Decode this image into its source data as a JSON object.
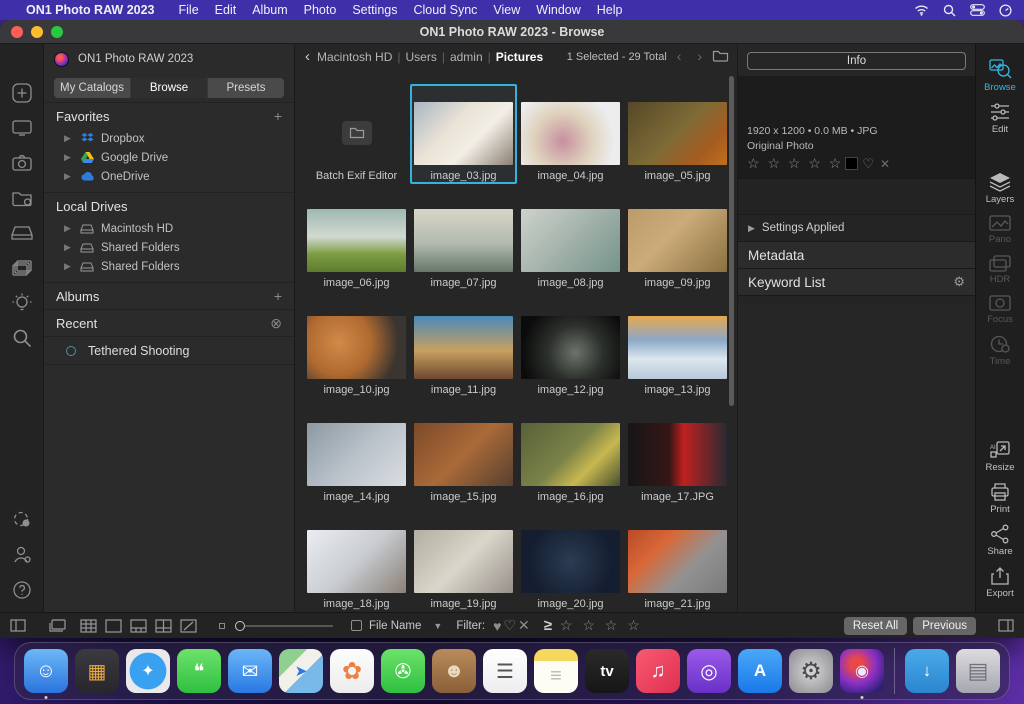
{
  "menu_bar": {
    "apple": "",
    "app_name": "ON1 Photo RAW 2023",
    "items": [
      "File",
      "Edit",
      "Album",
      "Photo",
      "Settings",
      "Cloud Sync",
      "View",
      "Window",
      "Help"
    ]
  },
  "window": {
    "title": "ON1 Photo RAW 2023 - Browse"
  },
  "sidebar": {
    "app_label": "ON1 Photo RAW 2023",
    "tabs": [
      {
        "label": "My Catalogs"
      },
      {
        "label": "Browse"
      },
      {
        "label": "Presets"
      }
    ],
    "favorites": {
      "title": "Favorites",
      "add": "+",
      "items": [
        {
          "label": "Dropbox"
        },
        {
          "label": "Google Drive"
        },
        {
          "label": "OneDrive"
        }
      ]
    },
    "local_drives": {
      "title": "Local Drives",
      "items": [
        {
          "label": "Macintosh HD"
        },
        {
          "label": "Shared Folders"
        },
        {
          "label": "Shared Folders"
        }
      ]
    },
    "albums": {
      "title": "Albums",
      "add": "+"
    },
    "recent": {
      "title": "Recent",
      "clear": "⊗"
    },
    "tethered": {
      "label": "Tethered Shooting"
    }
  },
  "main": {
    "breadcrumb": {
      "back": "‹",
      "parts": [
        "Macintosh HD",
        "Users",
        "admin"
      ],
      "current": "Pictures"
    },
    "selection": "1 Selected - 29 Total",
    "nav_arrows": "‹ ›",
    "grid": {
      "items": [
        {
          "type": "folder",
          "label": "Batch Exif Editor"
        },
        {
          "type": "image",
          "label": "image_03.jpg",
          "selected": true,
          "bg": "linear-gradient(135deg,#a8b6c2 0%,#e9e2d6 38%,#f3efe6 62%,#8a7f72 100%)"
        },
        {
          "type": "image",
          "label": "image_04.jpg",
          "bg": "radial-gradient(circle at 42% 62%,#c78fa0 0%,#dfd3bd 42%,#ededef 75%)"
        },
        {
          "type": "image",
          "label": "image_05.jpg",
          "bg": "linear-gradient(135deg,#564728 0%,#7c6b36 48%,#a65c20 78%,#c2701e 100%)"
        },
        {
          "type": "image",
          "label": "image_06.jpg",
          "bg": "linear-gradient(180deg,#9db9b1 0%,#d2d9d0 44%,#7d9c42 72%,#5d7c30 100%)"
        },
        {
          "type": "image",
          "label": "image_07.jpg",
          "bg": "linear-gradient(180deg,#d9d5c8 0%,#b2bab0 55%,#66766a 100%)"
        },
        {
          "type": "image",
          "label": "image_08.jpg",
          "bg": "linear-gradient(135deg,#cdd3cb 0%,#a2b2aa 50%,#74948a 100%)"
        },
        {
          "type": "image",
          "label": "image_09.jpg",
          "bg": "linear-gradient(135deg,#bb9b6a 0%,#cbab7a 42%,#8a7040 100%)"
        },
        {
          "type": "image",
          "label": "image_10.jpg",
          "bg": "radial-gradient(circle at 32% 42%,#d28a48 0%,#b06a30 42%,#3a3530 78%)"
        },
        {
          "type": "image",
          "label": "image_11.jpg",
          "bg": "linear-gradient(180deg,#4a8ab8 0%,#c8a060 55%,#6e4830 100%)"
        },
        {
          "type": "image",
          "label": "image_12.jpg",
          "bg": "radial-gradient(circle at 55% 58%,#6c746c 0%,#2c302c 42%,#0b0b0b 82%)"
        },
        {
          "type": "image",
          "label": "image_13.jpg",
          "bg": "linear-gradient(180deg,#e8a850 0%,#8aa8c8 38%,#dde7ee 68%,#b8c8d8 100%)"
        },
        {
          "type": "image",
          "label": "image_14.jpg",
          "bg": "linear-gradient(135deg,#8c98a2 0%,#bac2ca 52%,#dadee2 100%)"
        },
        {
          "type": "image",
          "label": "image_15.jpg",
          "bg": "linear-gradient(135deg,#7c4a2a 0%,#aa6a38 50%,#564030 100%)"
        },
        {
          "type": "image",
          "label": "image_16.jpg",
          "bg": "linear-gradient(135deg,#596038 0%,#7a8248 48%,#c8b850 70%,#475030 100%)"
        },
        {
          "type": "image",
          "label": "image_17.JPG",
          "bg": "linear-gradient(90deg,#161616 0%,#361616 42%,#c02020 56%,#2a2a32 100%)"
        },
        {
          "type": "image",
          "label": "image_18.jpg",
          "bg": "linear-gradient(135deg,#eaeef2 0%,#c9cdd1 50%,#8a8078 100%)"
        },
        {
          "type": "image",
          "label": "image_19.jpg",
          "bg": "linear-gradient(135deg,#b2aea2 0%,#dad6ca 50%,#96908a 100%)"
        },
        {
          "type": "image",
          "label": "image_20.jpg",
          "bg": "radial-gradient(circle at 50% 50%,#2c3c52 0%,#141e30 72%)"
        },
        {
          "type": "image",
          "label": "image_21.jpg",
          "bg": "linear-gradient(135deg,#ba4a28 0%,#d86838 30%,#929292 62%,#7a7a7a 100%)"
        }
      ]
    }
  },
  "info_panel": {
    "info_button": "Info",
    "dimensions": "1920 x 1200  •  0.0 MB  •  JPG",
    "photo_type": "Original Photo",
    "stars": "☆ ☆ ☆ ☆ ☆",
    "heart": "♡",
    "reject": "✕",
    "settings_applied": "Settings Applied",
    "metadata": "Metadata",
    "keyword_list": "Keyword List",
    "gear": "⚙"
  },
  "right_rail": {
    "tools": [
      {
        "label": "Browse"
      },
      {
        "label": "Edit"
      },
      {
        "label": "Layers"
      },
      {
        "label": "Pano"
      },
      {
        "label": "HDR"
      },
      {
        "label": "Focus"
      },
      {
        "label": "Time"
      },
      {
        "label": "Resize"
      },
      {
        "label": "Print"
      },
      {
        "label": "Share"
      },
      {
        "label": "Export"
      }
    ]
  },
  "bottom_bar": {
    "file_name": "File Name",
    "filter_label": "Filter:",
    "heart_filled": "♥",
    "heart_outline": "♡",
    "reject": "✕",
    "gte": "≥",
    "stars": "☆ ☆ ☆ ☆",
    "reset_all": "Reset All",
    "previous": "Previous"
  },
  "dock": {
    "items": [
      {
        "name": "finder",
        "glyph": "☺",
        "bg": "linear-gradient(180deg,#6cb8f6 0%,#2a74de 100%)",
        "running": true
      },
      {
        "name": "launchpad",
        "glyph": "▦",
        "bg": "linear-gradient(180deg,#3a3a40 0%,#26262c 100%)"
      },
      {
        "name": "safari",
        "glyph": "✦",
        "bg": "radial-gradient(circle,#3aa0f0 58%,#e9e9ec 60%)"
      },
      {
        "name": "messages",
        "glyph": "❝",
        "bg": "linear-gradient(180deg,#6de26b 0%,#2fc041 100%)"
      },
      {
        "name": "mail",
        "glyph": "✉",
        "bg": "linear-gradient(180deg,#6ab6f8 0%,#2a78e2 100%)"
      },
      {
        "name": "maps",
        "glyph": "➤",
        "bg": "linear-gradient(135deg,#8ed08e 32%,#f1f1e9 32%,#f1f1e9 56%,#79b9e9 56%)"
      },
      {
        "name": "photos",
        "glyph": "✿",
        "bg": "linear-gradient(180deg,#fdfdfd 0%,#ececec 100%)"
      },
      {
        "name": "facetime",
        "glyph": "✇",
        "bg": "linear-gradient(180deg,#6de26b 0%,#2fc041 100%)"
      },
      {
        "name": "contacts",
        "glyph": "☻",
        "bg": "linear-gradient(180deg,#b98b5c 0%,#8a6038 100%)"
      },
      {
        "name": "reminders",
        "glyph": "☰",
        "bg": "linear-gradient(180deg,#ffffff 0%,#ededef 100%)"
      },
      {
        "name": "notes",
        "glyph": "≡",
        "bg": "linear-gradient(180deg,#f7d75e 27%,#fdfdf6 27%)"
      },
      {
        "name": "appletv",
        "glyph": "tv",
        "bg": "linear-gradient(180deg,#2a2a2a 0%,#161616 100%)"
      },
      {
        "name": "music",
        "glyph": "♫",
        "bg": "linear-gradient(135deg,#fa5a72 0%,#dd3050 100%)"
      },
      {
        "name": "podcasts",
        "glyph": "◎",
        "bg": "linear-gradient(180deg,#9a5ae8 0%,#6930c8 100%)"
      },
      {
        "name": "appstore",
        "glyph": "A",
        "bg": "linear-gradient(180deg,#4aa8f8 0%,#1a78e8 100%)"
      },
      {
        "name": "system-settings",
        "glyph": "⚙",
        "bg": "radial-gradient(circle,#d8d8d8 0%,#8a8a90 100%)"
      },
      {
        "name": "on1-photo-raw",
        "glyph": "◉",
        "bg": "radial-gradient(circle at 38% 35%,#e8484a 16%,#8a30c8 48%,#2a2070 85%)",
        "running": true
      },
      {
        "name": "downloads",
        "glyph": "↓",
        "bg": "linear-gradient(180deg,#4aaae8 0%,#2a86d0 100%)"
      },
      {
        "name": "trash",
        "glyph": "▤",
        "bg": "linear-gradient(180deg,#dcdce0 0%,#a6a6ae 100%)"
      }
    ]
  }
}
